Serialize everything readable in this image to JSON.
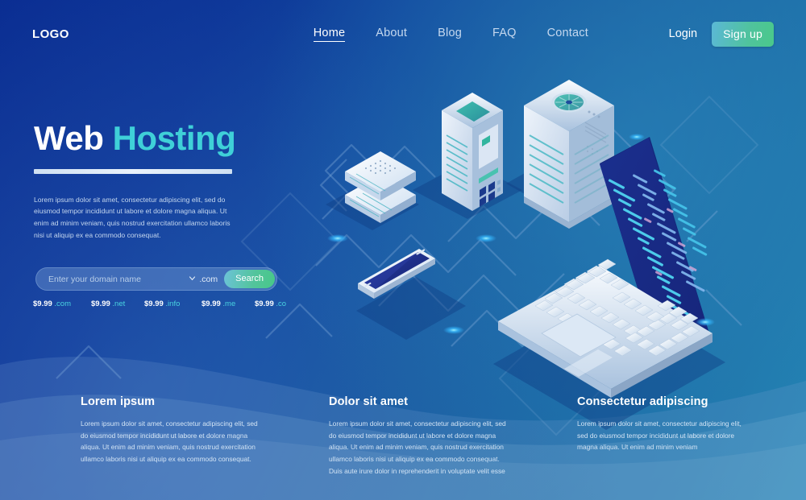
{
  "brand": {
    "logo": "LOGO"
  },
  "nav": {
    "links": [
      {
        "label": "Home",
        "active": true
      },
      {
        "label": "About",
        "active": false
      },
      {
        "label": "Blog",
        "active": false
      },
      {
        "label": "FAQ",
        "active": false
      },
      {
        "label": "Contact",
        "active": false
      }
    ],
    "login_label": "Login",
    "signup_label": "Sign up"
  },
  "hero": {
    "title_primary": "Web",
    "title_accent": "Hosting",
    "body": "Lorem ipsum dolor sit amet, consectetur adipiscing elit, sed do eiusmod tempor incididunt ut labore et dolore magna aliqua. Ut enim ad minim veniam, quis nostrud exercitation ullamco laboris nisi ut aliquip ex ea commodo consequat."
  },
  "search": {
    "placeholder": "Enter your domain name",
    "selected_tld": ".com",
    "button_label": "Search"
  },
  "prices": [
    {
      "amount": "$9.99",
      "tld": ".com"
    },
    {
      "amount": "$9.99",
      "tld": ".net"
    },
    {
      "amount": "$9.99",
      "tld": ".info"
    },
    {
      "amount": "$9.99",
      "tld": ".me"
    },
    {
      "amount": "$9.99",
      "tld": ".co"
    }
  ],
  "features": [
    {
      "title": "Lorem ipsum",
      "body": "Lorem ipsum dolor sit amet, consectetur adipiscing elit, sed do eiusmod tempor incididunt ut labore et dolore magna aliqua. Ut enim ad minim veniam, quis nostrud exercitation ullamco laboris nisi ut aliquip ex ea commodo consequat."
    },
    {
      "title": "Dolor sit amet",
      "body": "Lorem ipsum dolor sit amet, consectetur adipiscing elit, sed do eiusmod tempor incididunt ut labore et dolore magna aliqua. Ut enim ad minim veniam, quis nostrud exercitation ullamco laboris nisi ut aliquip ex ea commodo consequat. Duis aute irure dolor in reprehenderit in voluptate velit esse"
    },
    {
      "title": "Consectetur adipiscing",
      "body": "Lorem ipsum dolor sit amet, consectetur adipiscing elit, sed do eiusmod tempor incididunt ut labore et dolore magna aliqua. Ut enim ad minim veniam"
    }
  ],
  "illustration": {
    "elements": [
      "network-switch-icon",
      "server-tower-icon",
      "server-rack-icon",
      "smartphone-icon",
      "laptop-icon",
      "circuit-network-lines"
    ]
  },
  "colors": {
    "bg_deep_navy": "#0a2d92",
    "bg_steel_blue": "#2385b4",
    "accent_cyan": "#3fd0d8",
    "accent_green": "#4ac98a",
    "text_muted": "#c3d6ee"
  }
}
